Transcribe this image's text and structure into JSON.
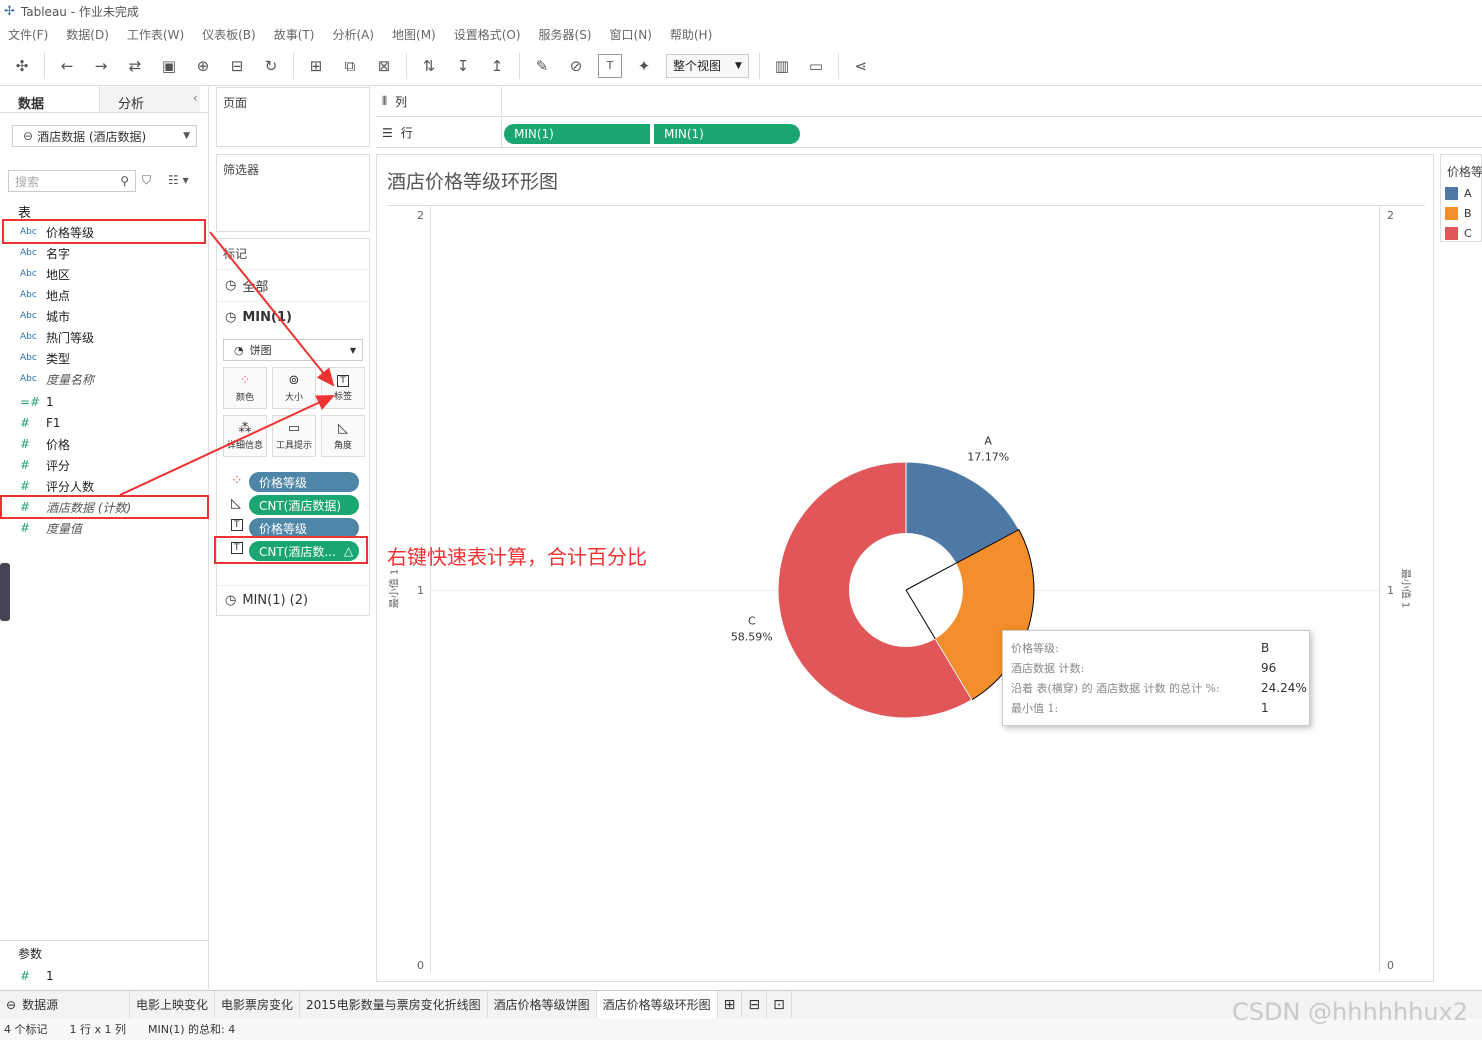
{
  "window": {
    "title": "Tableau - 作业未完成"
  },
  "menu": [
    "文件(F)",
    "数据(D)",
    "工作表(W)",
    "仪表板(B)",
    "故事(T)",
    "分析(A)",
    "地图(M)",
    "设置格式(O)",
    "服务器(S)",
    "窗口(N)",
    "帮助(H)"
  ],
  "toolbar": {
    "view_select": "整个视图"
  },
  "left": {
    "tab_data": "数据",
    "tab_analysis": "分析",
    "datasource": "酒店数据 (酒店数据)",
    "search_placeholder": "搜索",
    "section_table": "表",
    "dims": [
      "价格等级",
      "名字",
      "地区",
      "地点",
      "城市",
      "热门等级",
      "类型",
      "度量名称"
    ],
    "measures": [
      "1",
      "F1",
      "价格",
      "评分",
      "评分人数",
      "酒店数据 (计数)",
      "度量值"
    ],
    "section_params": "参数",
    "params": [
      "1"
    ]
  },
  "shelves": {
    "pages": "页面",
    "filters": "筛选器",
    "marks": "标记",
    "marks_all": "全部",
    "marks_min1": "MIN(1)",
    "mark_type": "饼图",
    "btn_color": "颜色",
    "btn_size": "大小",
    "btn_label": "标签",
    "btn_detail": "详细信息",
    "btn_tooltip": "工具提示",
    "btn_angle": "角度",
    "pills": [
      "价格等级",
      "CNT(酒店数据)",
      "价格等级",
      "CNT(酒店数..."
    ],
    "marks_min1_2": "MIN(1) (2)",
    "columns": "列",
    "rows": "行",
    "row_pills": [
      "MIN(1)",
      "MIN(1)"
    ]
  },
  "view": {
    "title": "酒店价格等级环形图",
    "axis_top": "2",
    "axis_mid": "1",
    "axis_bottom": "0",
    "axis_label": "最小值 1",
    "annotation": "右键快速表计算，合计百分比"
  },
  "chart_data": {
    "type": "pie",
    "title": "酒店价格等级环形图",
    "categories": [
      "A",
      "B",
      "C"
    ],
    "values": [
      17.17,
      24.24,
      58.59
    ],
    "labels": [
      "17.17%",
      "24.24%",
      "58.59%"
    ],
    "colors": [
      "#4e79a7",
      "#f28e2b",
      "#e15759"
    ],
    "donut": true
  },
  "legend": {
    "title": "价格等",
    "items": [
      "A",
      "B",
      "C"
    ]
  },
  "tooltip": {
    "k1": "价格等级:",
    "v1": "B",
    "k2": "酒店数据 计数:",
    "v2": "96",
    "k3": "沿着 表(横穿) 的 酒店数据 计数 的总计 %:",
    "v3": "24.24%",
    "k4": "最小值 1:",
    "v4": "1"
  },
  "sheets": [
    "数据源",
    "电影上映变化",
    "电影票房变化",
    "2015电影数量与票房变化折线图",
    "酒店价格等级饼图",
    "酒店价格等级环形图"
  ],
  "status": {
    "marks": "4 个标记",
    "rowcol": "1 行 x 1 列",
    "sum": "MIN(1) 的总和: 4"
  },
  "watermark": "CSDN @hhhhhhux2"
}
